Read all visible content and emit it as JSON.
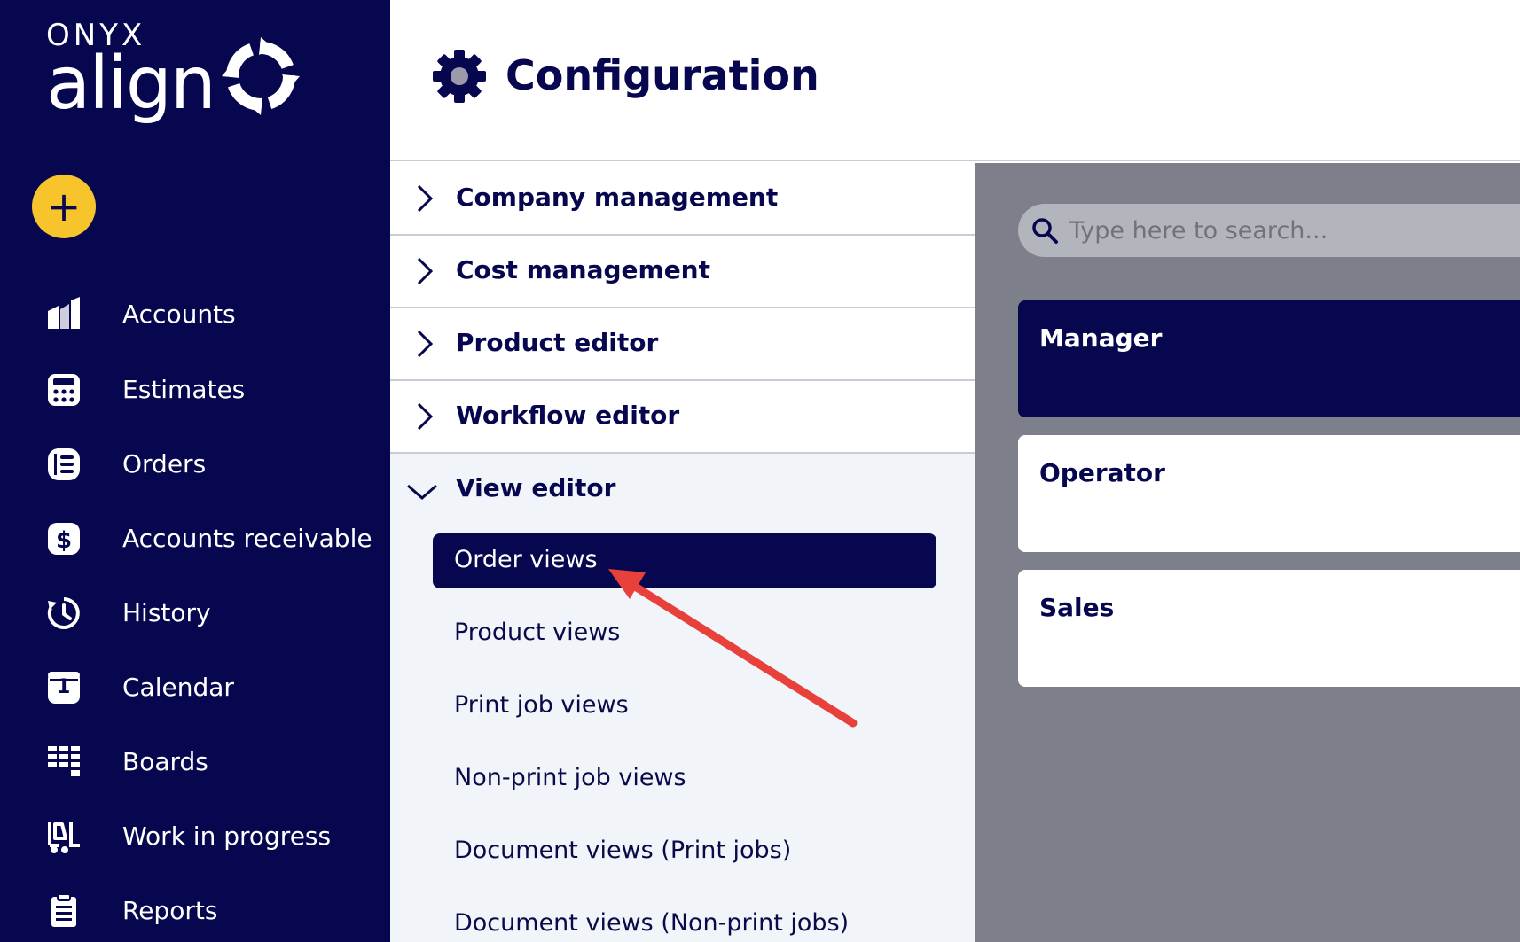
{
  "app": {
    "brand": "ONYX",
    "product": "align"
  },
  "sidebar": {
    "add_label": "+",
    "items": [
      {
        "label": "Accounts",
        "icon": "accounts-icon"
      },
      {
        "label": "Estimates",
        "icon": "calculator-icon"
      },
      {
        "label": "Orders",
        "icon": "orders-icon"
      },
      {
        "label": "Accounts receivable",
        "icon": "dollar-icon"
      },
      {
        "label": "History",
        "icon": "history-icon"
      },
      {
        "label": "Calendar",
        "icon": "calendar-icon"
      },
      {
        "label": "Boards",
        "icon": "boards-icon"
      },
      {
        "label": "Work in progress",
        "icon": "forklift-icon"
      },
      {
        "label": "Reports",
        "icon": "clipboard-icon"
      }
    ],
    "calendar_day": "1"
  },
  "header": {
    "title": "Configuration",
    "icon": "gear-icon"
  },
  "menu": {
    "sections": [
      {
        "label": "Company management",
        "expanded": false
      },
      {
        "label": "Cost management",
        "expanded": false
      },
      {
        "label": "Product editor",
        "expanded": false
      },
      {
        "label": "Workflow editor",
        "expanded": false
      }
    ],
    "view_editor": {
      "label": "View editor",
      "expanded": true,
      "items": [
        {
          "label": "Order views",
          "active": true
        },
        {
          "label": "Product views",
          "active": false
        },
        {
          "label": "Print job views",
          "active": false
        },
        {
          "label": "Non-print job views",
          "active": false
        },
        {
          "label": "Document views (Print jobs)",
          "active": false
        },
        {
          "label": "Document views (Non-print jobs)",
          "active": false
        }
      ]
    }
  },
  "right_panel": {
    "search": {
      "placeholder": "Type here to search...",
      "value": ""
    },
    "roles": [
      {
        "label": "Manager",
        "selected": true
      },
      {
        "label": "Operator",
        "selected": false
      },
      {
        "label": "Sales",
        "selected": false
      }
    ]
  },
  "colors": {
    "sidebar_bg": "#070750",
    "accent_yellow": "#f7c52b",
    "panel_gray": "#7d7f8a",
    "annotation_red": "#e8413c"
  }
}
